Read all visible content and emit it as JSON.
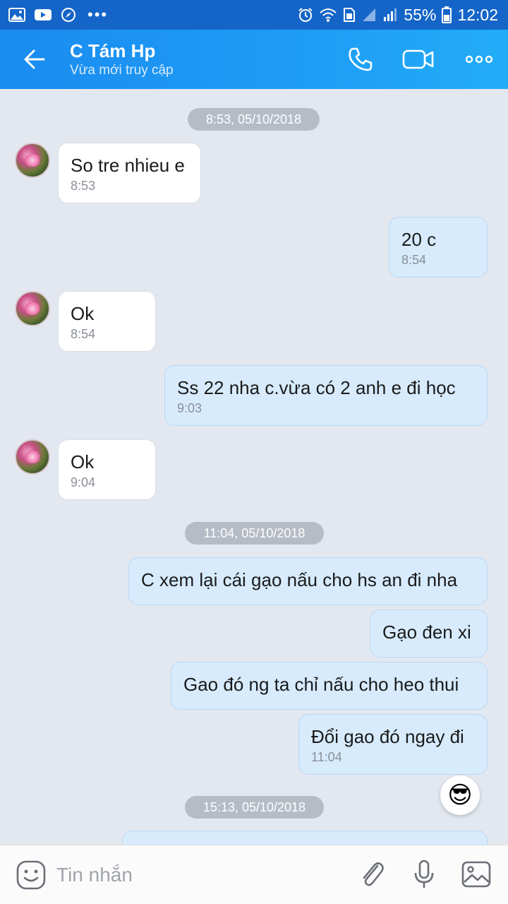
{
  "status_bar": {
    "battery": "55%",
    "time": "12:02",
    "dots": "•••"
  },
  "header": {
    "contact_name": "C Tám Hp",
    "contact_status": "Vừa mới truy cập"
  },
  "chat": {
    "date_separators": [
      "8:53, 05/10/2018",
      "11:04, 05/10/2018",
      "15:13, 05/10/2018"
    ],
    "messages": [
      {
        "direction": "in",
        "text": "So tre nhieu e",
        "time": "8:53"
      },
      {
        "direction": "out",
        "text": "20 c",
        "time": "8:54"
      },
      {
        "direction": "in",
        "text": "Ok",
        "time": "8:54"
      },
      {
        "direction": "out",
        "text": "Ss 22 nha c.vừa có 2 anh e đi học",
        "time": "9:03"
      },
      {
        "direction": "in",
        "text": "Ok",
        "time": "9:04"
      },
      {
        "direction": "out",
        "text": "C xem lại cái gạo nấu cho hs an đi nha",
        "time": ""
      },
      {
        "direction": "out",
        "text": "Gạo đen xi",
        "time": ""
      },
      {
        "direction": "out",
        "text": "Gao đó ng ta chỉ nấu cho heo thui",
        "time": ""
      },
      {
        "direction": "out",
        "text": "Đổi gao đó ngay đi",
        "time": "11:04"
      }
    ],
    "sticker": "😎"
  },
  "input_bar": {
    "placeholder": "Tin nhắn"
  },
  "colors": {
    "header": "#1e9df5",
    "status_bar": "#1565c8",
    "outgoing_bubble": "#d7ebfd",
    "incoming_bubble": "#ffffff",
    "chat_bg": "#e3e8f0"
  }
}
